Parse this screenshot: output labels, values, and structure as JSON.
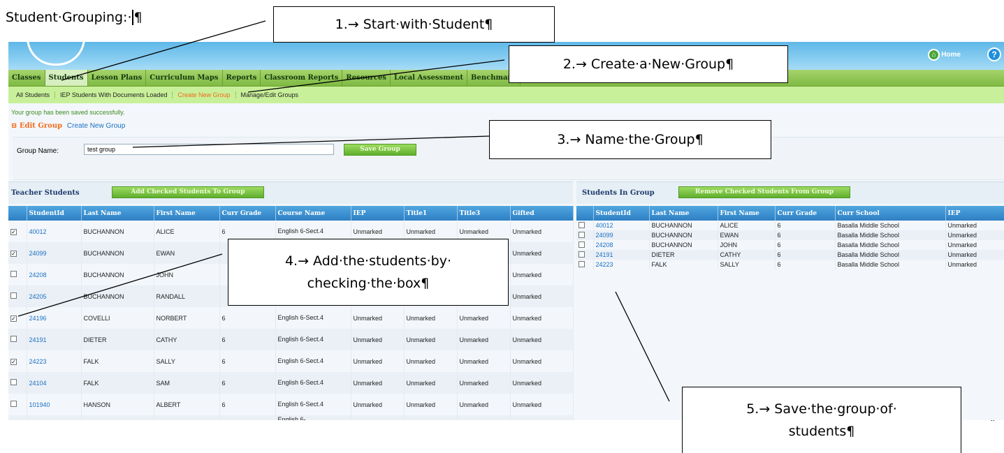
{
  "doc": {
    "heading": "Student·Grouping:·",
    "pilcrow": "¶"
  },
  "callouts": {
    "c1": "1.→ Start·with·Student¶",
    "c2": "2.→ Create·a·New·Group¶",
    "c3": "3.→ Name·the·Group¶",
    "c4_line1": "4.→ Add·the·students·by·",
    "c4_line2": "checking·the·box¶",
    "c5_line1": "5.→ Save·the·group·of·",
    "c5_line2": "students¶"
  },
  "app": {
    "home_label": "Home",
    "home_icon": "home-icon",
    "help_icon": "help-icon",
    "nav": [
      "Classes",
      "Students",
      "Lesson Plans",
      "Curriculum Maps",
      "Reports",
      "Classroom Reports",
      "Resources",
      "Local Assessment",
      "Benchmark"
    ],
    "subnav": [
      "All Students",
      "IEP Students With Documents Loaded",
      "Create New Group",
      "Manage/Edit Groups"
    ],
    "message": "Your group has been saved successfully.",
    "edit_group": "⊟ Edit Group",
    "create_new_group": "Create New Group",
    "group_name_label": "Group Name:",
    "group_name_value": "test group",
    "save_group": "Save Group",
    "teacher_students_title": "Teacher Students",
    "add_checked": "Add Checked Students To Group",
    "students_in_group_title": "Students In Group",
    "remove_checked": "Remove Checked Students From Group"
  },
  "teacher_table": {
    "headers": [
      "",
      "StudentId",
      "Last Name",
      "First Name",
      "Curr Grade",
      "Course Name",
      "IEP",
      "Title1",
      "Title3",
      "Gifted"
    ],
    "rows": [
      {
        "checked": true,
        "id": "40012",
        "last": "BUCHANNON",
        "first": "ALICE",
        "grade": "6",
        "course": "English 6-Sect.4",
        "iep": "Unmarked",
        "t1": "Unmarked",
        "t3": "Unmarked",
        "gifted": "Unmarked"
      },
      {
        "checked": true,
        "id": "24099",
        "last": "BUCHANNON",
        "first": "EWAN",
        "grade": "",
        "course": "",
        "iep": "",
        "t1": "",
        "t3": "",
        "gifted": "Unmarked"
      },
      {
        "checked": false,
        "id": "24208",
        "last": "BUCHANNON",
        "first": "JOHN",
        "grade": "",
        "course": "",
        "iep": "",
        "t1": "",
        "t3": "",
        "gifted": "Unmarked"
      },
      {
        "checked": false,
        "id": "24205",
        "last": "BUCHANNON",
        "first": "RANDALL",
        "grade": "",
        "course": "",
        "iep": "",
        "t1": "",
        "t3": "",
        "gifted": "Unmarked"
      },
      {
        "checked": true,
        "id": "24196",
        "last": "COVELLI",
        "first": "NORBERT",
        "grade": "6",
        "course": "English 6-Sect.4",
        "iep": "Unmarked",
        "t1": "Unmarked",
        "t3": "Unmarked",
        "gifted": "Unmarked"
      },
      {
        "checked": false,
        "id": "24191",
        "last": "DIETER",
        "first": "CATHY",
        "grade": "6",
        "course": "English 6-Sect.4",
        "iep": "Unmarked",
        "t1": "Unmarked",
        "t3": "Unmarked",
        "gifted": "Unmarked"
      },
      {
        "checked": true,
        "id": "24223",
        "last": "FALK",
        "first": "SALLY",
        "grade": "6",
        "course": "English 6-Sect.4",
        "iep": "Unmarked",
        "t1": "Unmarked",
        "t3": "Unmarked",
        "gifted": "Unmarked"
      },
      {
        "checked": false,
        "id": "24104",
        "last": "FALK",
        "first": "SAM",
        "grade": "6",
        "course": "English 6-Sect.4",
        "iep": "Unmarked",
        "t1": "Unmarked",
        "t3": "Unmarked",
        "gifted": "Unmarked"
      },
      {
        "checked": false,
        "id": "101940",
        "last": "HANSON",
        "first": "ALBERT",
        "grade": "6",
        "course": "English 6-Sect.4",
        "iep": "Unmarked",
        "t1": "Unmarked",
        "t3": "Unmarked",
        "gifted": "Unmarked"
      },
      {
        "checked": false,
        "id": "",
        "last": "",
        "first": "",
        "grade": "",
        "course": "English 6-",
        "iep": "",
        "t1": "",
        "t3": "",
        "gifted": ""
      }
    ]
  },
  "group_table": {
    "headers": [
      "",
      "StudentId",
      "Last Name",
      "First Name",
      "Curr Grade",
      "Curr School",
      "IEP"
    ],
    "rows": [
      {
        "id": "40012",
        "last": "BUCHANNON",
        "first": "ALICE",
        "grade": "6",
        "school": "Basalla Middle School",
        "iep": "Unmarked"
      },
      {
        "id": "24099",
        "last": "BUCHANNON",
        "first": "EWAN",
        "grade": "6",
        "school": "Basalla Middle School",
        "iep": "Unmarked"
      },
      {
        "id": "24208",
        "last": "BUCHANNON",
        "first": "JOHN",
        "grade": "6",
        "school": "Basalla Middle School",
        "iep": "Unmarked"
      },
      {
        "id": "24191",
        "last": "DIETER",
        "first": "CATHY",
        "grade": "6",
        "school": "Basalla Middle School",
        "iep": "Unmarked"
      },
      {
        "id": "24223",
        "last": "FALK",
        "first": "SALLY",
        "grade": "6",
        "school": "Basalla Middle School",
        "iep": "Unmarked"
      }
    ]
  }
}
